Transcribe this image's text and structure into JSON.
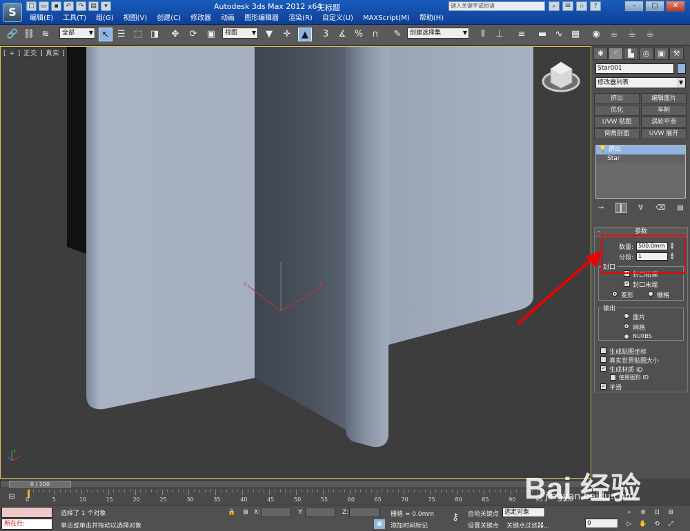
{
  "titlebar": {
    "app_title": "Autodesk 3ds Max  2012 x64",
    "doc_title": "无标题",
    "search_placeholder": "键入关键字或短语",
    "menus": [
      "编辑(E)",
      "工具(T)",
      "组(G)",
      "视图(V)",
      "创建(C)",
      "修改器",
      "动画",
      "图形编辑器",
      "渲染(R)",
      "自定义(U)",
      "MAXScript(M)",
      "帮助(H)"
    ]
  },
  "toolbar": {
    "filter_select": "全部",
    "ref_coord_select": "视图",
    "named_selection": "创建选择集"
  },
  "viewport": {
    "label": "[ + ] 正交 ] 真实 ]",
    "axis_x": "x",
    "axis_y": "y",
    "axis_z": "z"
  },
  "command_panel": {
    "object_name": "Star001",
    "modifier_list": "修改器列表",
    "modifier_buttons": [
      "挤出",
      "编辑面片",
      "优化",
      "车削",
      "UVW 贴图",
      "涡轮平滑",
      "倒角剖面",
      "UVW 展开"
    ],
    "stack": [
      "挤出",
      "Star"
    ],
    "rollout_title": "参数",
    "amount_label": "数量:",
    "amount_value": "500.0mm",
    "segments_label": "分段:",
    "segments_value": "1",
    "capping_group": "封口",
    "cap_start": "封口始端",
    "cap_end": "封口末端",
    "morph": "变形",
    "grid": "栅格",
    "output_group": "输出",
    "out_patch": "面片",
    "out_mesh": "网格",
    "out_nurbs": "NURBS",
    "gen_mapping": "生成贴图坐标",
    "real_world": "真实世界贴图大小",
    "gen_matid": "生成材质 ID",
    "use_shape_id": "使用图形 ID",
    "smooth": "平滑"
  },
  "timeline": {
    "slider_label": "0 / 100",
    "ticks": [
      "0",
      "5",
      "10",
      "15",
      "20",
      "25",
      "30",
      "35",
      "40",
      "45",
      "50",
      "55",
      "60",
      "65",
      "70",
      "75",
      "80",
      "85",
      "90",
      "95",
      "100"
    ]
  },
  "statusbar": {
    "listener_text": "所在行:",
    "status1": "选择了 1 个对象",
    "status2": "单击或单击并拖动以选择对象",
    "x_label": "X:",
    "y_label": "Y:",
    "z_label": "Z:",
    "grid": "栅格 = 0.0mm",
    "add_time_tag": "添加时间标记",
    "auto_key": "自动关键点",
    "set_key": "设置关键点",
    "selected_sel": "选定对象",
    "key_filters": "关键点过滤器...",
    "frame": "0"
  },
  "watermark": {
    "brand": "Bai 经验",
    "url": "jingyan.baidu.com"
  }
}
